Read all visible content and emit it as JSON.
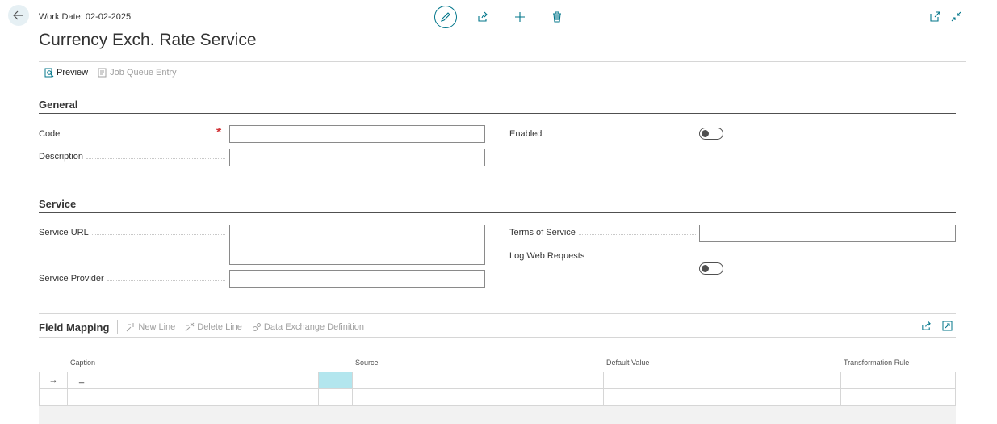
{
  "header": {
    "work_date": "Work Date: 02-02-2025",
    "title": "Currency Exch. Rate Service"
  },
  "icons": {
    "back": "back-arrow-icon",
    "edit": "pencil-icon",
    "share": "share-icon",
    "add": "plus-icon",
    "delete": "trash-icon",
    "open_new": "open-in-new-window-icon",
    "collapse": "collapse-icon"
  },
  "actions": {
    "preview": "Preview",
    "job_queue_entry": "Job Queue Entry"
  },
  "general": {
    "title": "General",
    "code_label": "Code",
    "code_value": "",
    "description_label": "Description",
    "description_value": "",
    "enabled_label": "Enabled",
    "enabled": false
  },
  "service": {
    "title": "Service",
    "url_label": "Service URL",
    "url_value": "",
    "provider_label": "Service Provider",
    "provider_value": "",
    "terms_label": "Terms of Service",
    "terms_value": "",
    "log_label": "Log Web Requests",
    "log_enabled": false
  },
  "field_mapping": {
    "title": "Field Mapping",
    "new_line": "New Line",
    "delete_line": "Delete Line",
    "data_exchange_definition": "Data Exchange Definition",
    "columns": [
      "Caption",
      "Source",
      "Default Value",
      "Transformation Rule"
    ],
    "rows": [
      {
        "indicator": "→",
        "caption": "_",
        "source": "",
        "default_value": "",
        "transformation_rule": ""
      },
      {
        "indicator": "",
        "caption": "",
        "source": "",
        "default_value": "",
        "transformation_rule": ""
      }
    ]
  },
  "colors": {
    "accent": "#00758a",
    "required": "#d13438",
    "selected_cell": "#b3e6ee"
  }
}
